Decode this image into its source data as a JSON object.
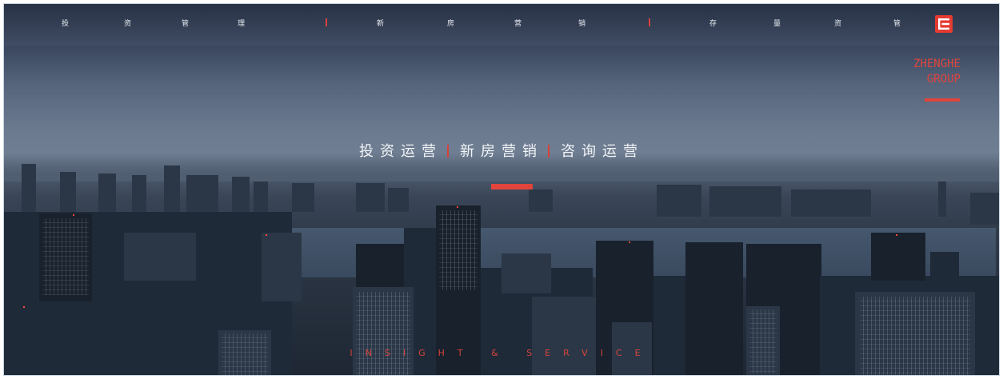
{
  "nav": {
    "group1": [
      "投",
      "资",
      "管",
      "理"
    ],
    "group2": [
      "新",
      "房",
      "营",
      "销"
    ],
    "group3": [
      "存",
      "量",
      "资",
      "管"
    ]
  },
  "logo_icon": "zhenghe-logo-icon",
  "brand": {
    "line1": "ZHENGHE",
    "line2": "GROUP"
  },
  "headline": {
    "part1": "投资运营",
    "part2": "新房营销",
    "part3": "咨询运营"
  },
  "tagline": "INSIGHT & SERVICE",
  "colors": {
    "accent": "#e0443b",
    "sky_top": "#2f3c52",
    "city": "#1f2a38"
  }
}
